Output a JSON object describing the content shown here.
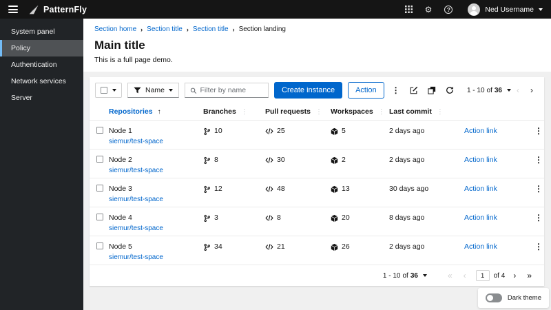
{
  "colors": {
    "accent": "#0066cc",
    "masthead_bg": "#151515",
    "sidebar_bg": "#212427",
    "sidebar_selected_bg": "#4f5255",
    "sidebar_selected_border": "#73bcf7",
    "content_bg": "#f0f0f0",
    "card_bg": "#ffffff"
  },
  "icons": {
    "breadcrumb_separator": "›",
    "kebab": "⋮",
    "sort_asc": "↑",
    "gear": "⚙",
    "help": "?",
    "chevron_left": "‹",
    "chevron_right": "›",
    "first_page": "«",
    "last_page": "»"
  },
  "masthead": {
    "brand": "PatternFly",
    "user": "Ned Username"
  },
  "sidebar": {
    "items": [
      {
        "label": "System panel"
      },
      {
        "label": "Policy"
      },
      {
        "label": "Authentication"
      },
      {
        "label": "Network services"
      },
      {
        "label": "Server"
      }
    ]
  },
  "breadcrumb": {
    "items": [
      "Section home",
      "Section title",
      "Section title",
      "Section landing"
    ]
  },
  "page": {
    "title": "Main title",
    "description": "This is a full page demo."
  },
  "toolbar": {
    "filter_label": "Name",
    "search_placeholder": "Filter by name",
    "create_button": "Create instance",
    "action_button": "Action"
  },
  "pagination_top": {
    "range": "1 - 10",
    "of_word": "of",
    "total": "36"
  },
  "table": {
    "columns": [
      "Repositories",
      "Branches",
      "Pull requests",
      "Workspaces",
      "Last commit"
    ],
    "rows": [
      {
        "name": "Node 1",
        "link": "siemur/test-space",
        "branches": "10",
        "pull_requests": "25",
        "workspaces": "5",
        "last_commit": "2 days ago",
        "action": "Action link"
      },
      {
        "name": "Node 2",
        "link": "siemur/test-space",
        "branches": "8",
        "pull_requests": "30",
        "workspaces": "2",
        "last_commit": "2 days ago",
        "action": "Action link"
      },
      {
        "name": "Node 3",
        "link": "siemur/test-space",
        "branches": "12",
        "pull_requests": "48",
        "workspaces": "13",
        "last_commit": "30 days ago",
        "action": "Action link"
      },
      {
        "name": "Node 4",
        "link": "siemur/test-space",
        "branches": "3",
        "pull_requests": "8",
        "workspaces": "20",
        "last_commit": "8 days ago",
        "action": "Action link"
      },
      {
        "name": "Node 5",
        "link": "siemur/test-space",
        "branches": "34",
        "pull_requests": "21",
        "workspaces": "26",
        "last_commit": "2 days ago",
        "action": "Action link"
      }
    ]
  },
  "pagination_bottom": {
    "range": "1 - 10",
    "of_word": "of",
    "total": "36",
    "current_page": "1",
    "pages_label": "of 4"
  },
  "theme_toggle": {
    "label": "Dark theme"
  }
}
